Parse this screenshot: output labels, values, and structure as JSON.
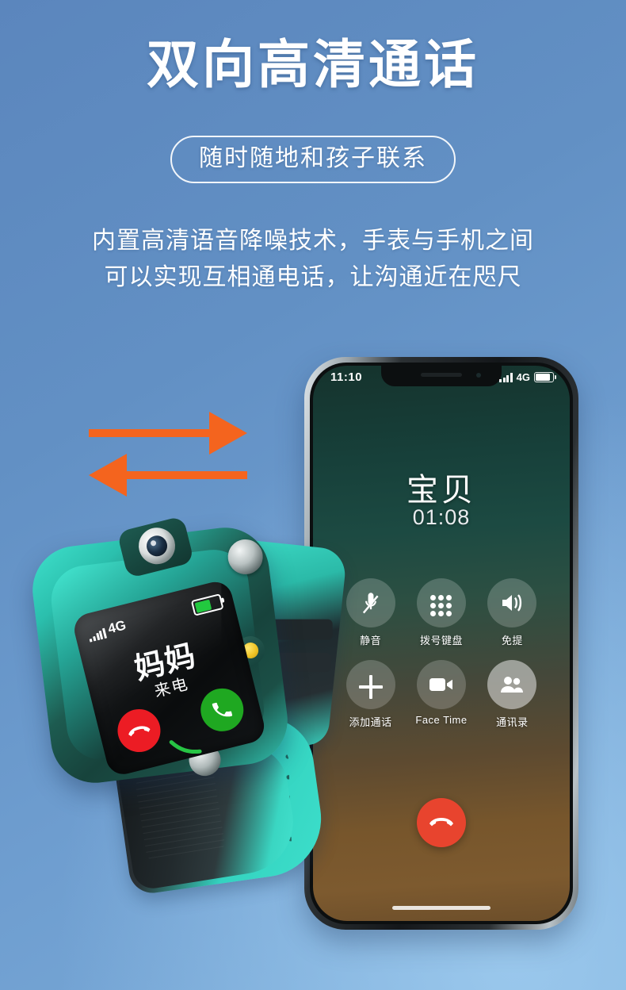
{
  "theme": {
    "bg_top": "#5b86bd",
    "bg_bottom": "#7cadda",
    "arrow_color": "#f4641e",
    "accent_white": "#ffffff",
    "watch_teal": "#3ee0cb",
    "watch_dark_green": "#17433c",
    "accept_green": "#1fa821",
    "decline_red": "#ec1c24",
    "endcall_red": "#e8442e"
  },
  "header": {
    "title": "双向高清通话",
    "pill_label": "随时随地和孩子联系",
    "description_line1": "内置高清语音降噪技术，手表与手机之间",
    "description_line2": "可以实现互相通电话，让沟通近在咫尺"
  },
  "arrows": {
    "right_label": "watch-to-phone",
    "left_label": "phone-to-watch"
  },
  "phone": {
    "status": {
      "time": "11:10",
      "network": "4G",
      "battery_level": "80"
    },
    "call": {
      "callee": "宝贝",
      "duration": "01:08"
    },
    "controls": [
      {
        "icon": "mute-icon",
        "label": "静音"
      },
      {
        "icon": "keypad-icon",
        "label": "拨号键盘"
      },
      {
        "icon": "speaker-icon",
        "label": "免提"
      },
      {
        "icon": "add-call-icon",
        "label": "添加通话"
      },
      {
        "icon": "facetime-icon",
        "label": "Face Time"
      },
      {
        "icon": "contacts-icon",
        "label": "通讯录"
      }
    ],
    "end_call_label": "结束通话"
  },
  "watch": {
    "status": {
      "network": "4G",
      "battery_level": "56"
    },
    "call": {
      "caller": "妈妈",
      "state": "来电"
    },
    "decline_label": "挂断",
    "accept_label": "接听"
  }
}
